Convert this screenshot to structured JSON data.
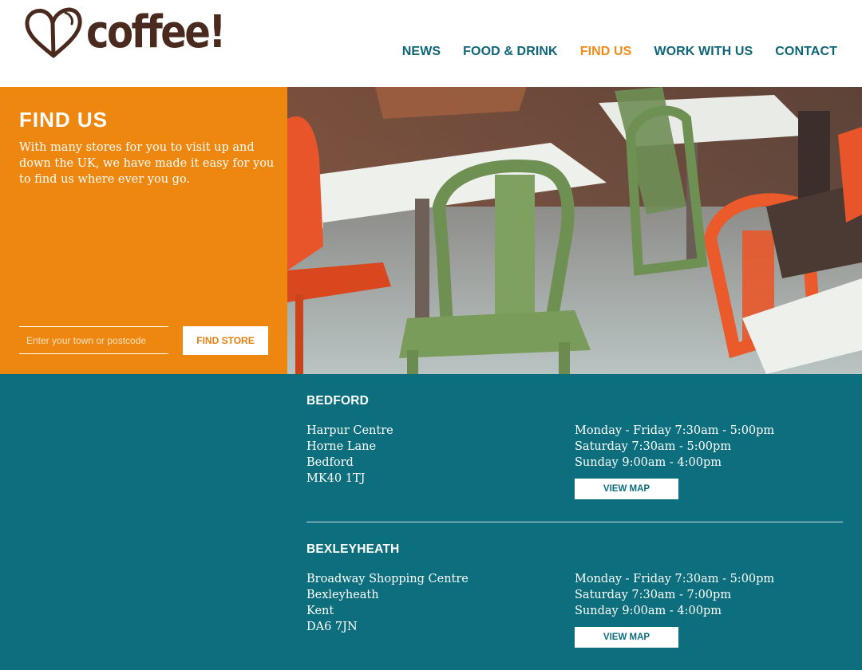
{
  "brand": {
    "name": "coffee!",
    "logo_color": "#4a2a1f"
  },
  "nav": {
    "items": [
      {
        "label": "NEWS",
        "active": false
      },
      {
        "label": "FOOD & DRINK",
        "active": false
      },
      {
        "label": "FIND US",
        "active": true
      },
      {
        "label": "WORK WITH US",
        "active": false
      },
      {
        "label": "CONTACT",
        "active": false
      }
    ]
  },
  "hero": {
    "title": "FIND US",
    "text": "With many stores for you to visit up and down the UK, we have made it easy for you to find us where ever you go.",
    "search": {
      "placeholder": "Enter your town or postcode",
      "value": ""
    },
    "button_label": "FIND STORE",
    "image": "cafe-tables-and-chairs-photo"
  },
  "stores": [
    {
      "name": "BEDFORD",
      "address": [
        "Harpur Centre",
        "Horne Lane",
        "Bedford",
        "MK40 1TJ"
      ],
      "hours": [
        "Monday - Friday 7:30am - 5:00pm",
        "Saturday 7:30am - 5:00pm",
        "Sunday 9:00am - 4:00pm"
      ],
      "map_label": "VIEW MAP"
    },
    {
      "name": "BEXLEYHEATH",
      "address": [
        "Broadway Shopping Centre",
        "Bexleyheath",
        "Kent",
        "DA6 7JN"
      ],
      "hours": [
        "Monday - Friday 7:30am - 5:00pm",
        "Saturday 7:30am - 7:00pm",
        "Sunday 9:00am - 4:00pm"
      ],
      "map_label": "VIEW MAP"
    }
  ],
  "colors": {
    "orange": "#ee870f",
    "teal": "#0d6f7e",
    "nav_text": "#0e6578",
    "nav_active": "#ef8b17"
  }
}
